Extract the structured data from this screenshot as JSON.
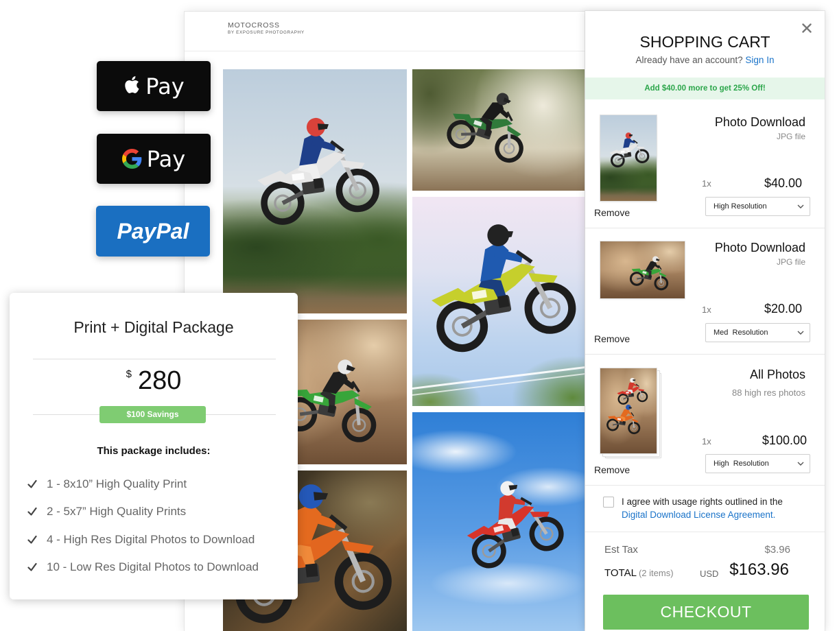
{
  "colors": {
    "checkout_green": "#6cbf5e",
    "savings_green": "#7fcc72",
    "promo_background": "#e6f6ea",
    "promo_text": "#2ca64b",
    "link_blue": "#1a73c9",
    "paypal_blue": "#1a6fc1",
    "pay_button_black": "#0b0b0b"
  },
  "icons": {
    "apple_pay": "apple-icon",
    "google_pay": "google-g-icon",
    "close": "close-icon",
    "package_list_bullet": "check-icon",
    "select_arrow": "chevron-down-icon"
  },
  "gallery": {
    "brand_title": "MOTOCROSS",
    "brand_subtitle": "BY EXPOSURE PHOTOGRAPHY"
  },
  "payment_buttons": {
    "apple_pay_label": "Pay",
    "google_pay_label": "Pay",
    "paypal_label": "PayPal"
  },
  "package": {
    "title": "Print + Digital Package",
    "currency_symbol": "$",
    "price": "280",
    "savings_badge": "$100 Savings",
    "includes_heading": "This package includes:",
    "items": [
      "1 - 8x10” High Quality Print",
      "2 - 5x7” High Quality Prints",
      "4 - High Res Digital Photos to Download",
      "10 - Low Res Digital Photos to Download"
    ]
  },
  "cart": {
    "title": "SHOPPING CART",
    "account_prompt": "Already have an account?",
    "sign_in_link": "Sign In",
    "promo_banner": "Add $40.00 more to get 25% Off!",
    "items": [
      {
        "name": "Photo Download",
        "detail": "JPG file",
        "quantity": "1x",
        "price": "$40.00",
        "resolution": "High Resolution",
        "remove_label": "Remove"
      },
      {
        "name": "Photo Download",
        "detail": "JPG file",
        "quantity": "1x",
        "price": "$20.00",
        "resolution": "Med  Resolution",
        "remove_label": "Remove"
      },
      {
        "name": "All Photos",
        "detail": "88 high res photos",
        "quantity": "1x",
        "price": "$100.00",
        "resolution": "High  Resolution",
        "remove_label": "Remove"
      }
    ],
    "agreement_text": "I agree with usage rights outlined in the",
    "agreement_link": "Digital Download License Agreement.",
    "agreement_checked": false,
    "est_tax_label": "Est Tax",
    "est_tax_value": "$3.96",
    "total_label": "TOTAL",
    "total_items": "(2 items)",
    "currency": "USD",
    "total_value": "$163.96",
    "checkout_label": "CHECKOUT"
  }
}
